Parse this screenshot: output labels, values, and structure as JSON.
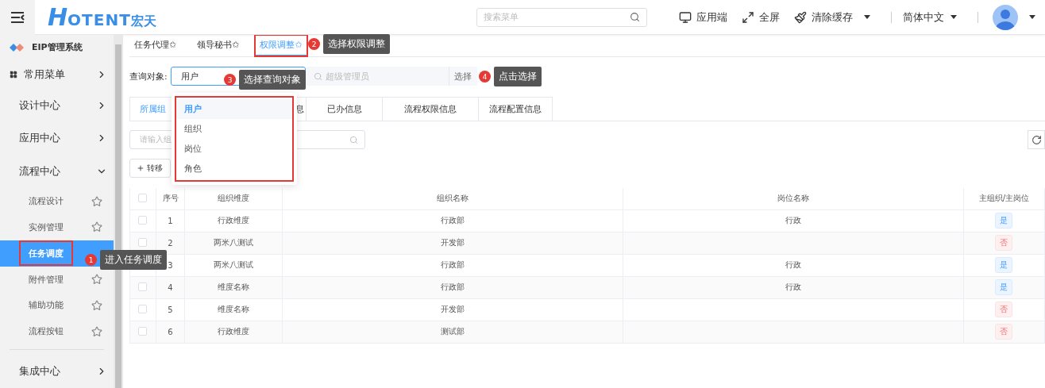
{
  "header": {
    "logo": {
      "mark": "H",
      "text": "OTENT",
      "suffix": "宏天"
    },
    "search": {
      "placeholder": "搜索菜单"
    },
    "actions": [
      {
        "kind": "monitor",
        "label": "应用端",
        "dropdown": false
      },
      {
        "kind": "expand",
        "label": "全屏",
        "dropdown": false
      },
      {
        "kind": "broom",
        "label": "清除缓存",
        "dropdown": true
      }
    ],
    "language": "简体中文"
  },
  "sidebar": {
    "title": "EIP管理系统",
    "items": [
      {
        "label": "常用菜单",
        "kind": "grid",
        "expanded": false
      },
      {
        "label": "设计中心",
        "expanded": false
      },
      {
        "label": "应用中心",
        "expanded": false
      },
      {
        "label": "流程中心",
        "expanded": true,
        "children": [
          {
            "label": "流程设计",
            "selected": false,
            "highlighted": false
          },
          {
            "label": "实例管理",
            "selected": false,
            "highlighted": false
          },
          {
            "label": "任务调度",
            "selected": true,
            "highlighted": true
          },
          {
            "label": "附件管理",
            "selected": false,
            "highlighted": false
          },
          {
            "label": "辅助功能",
            "selected": false,
            "highlighted": false
          },
          {
            "label": "流程按钮",
            "selected": false,
            "highlighted": false
          }
        ]
      },
      {
        "label": "集成中心",
        "expanded": false
      }
    ]
  },
  "page_tabs": [
    {
      "label": "任务代理✩",
      "selected": false,
      "highlighted": false
    },
    {
      "label": "领导秘书✩",
      "selected": false,
      "highlighted": false
    },
    {
      "label": "权限调整✩",
      "selected": true,
      "highlighted": true
    }
  ],
  "query": {
    "label": "查询对象:",
    "select": {
      "value": "用户"
    },
    "search": {
      "placeholder": "超级管理员"
    },
    "button": "选择"
  },
  "dropdown": {
    "highlighted": true,
    "options": [
      {
        "label": "用户",
        "selected": true
      },
      {
        "label": "组织",
        "selected": false
      },
      {
        "label": "岗位",
        "selected": false
      },
      {
        "label": "角色",
        "selected": false
      }
    ]
  },
  "sub_tabs": [
    {
      "label": "所属组",
      "selected": true
    },
    {
      "label": "息",
      "selected": false
    },
    {
      "label": "已办信息",
      "selected": false
    },
    {
      "label": "流程权限信息",
      "selected": false
    },
    {
      "label": "流程配置信息",
      "selected": false
    }
  ],
  "search": {
    "placeholder": "请输入组"
  },
  "toolbar": {
    "button": "转移"
  },
  "table": {
    "select_all": {
      "checked": false
    },
    "columns": [
      "序号",
      "组织维度",
      "组织名称",
      "岗位名称",
      "主组织/主岗位"
    ],
    "rows": [
      {
        "checked": false,
        "cells": [
          "1",
          "行政维度",
          "行政部",
          "行政"
        ],
        "primary": {
          "label": "是",
          "positive": true
        }
      },
      {
        "checked": false,
        "cells": [
          "2",
          "两米八测试",
          "开发部",
          ""
        ],
        "primary": {
          "label": "否",
          "positive": false
        }
      },
      {
        "cells": [
          "3",
          "两米八测试",
          "行政部",
          "行政"
        ],
        "primary": {
          "label": "是",
          "positive": true
        }
      },
      {
        "checked": false,
        "cells": [
          "4",
          "维度名称",
          "行政部",
          "行政"
        ],
        "primary": {
          "label": "是",
          "positive": true
        }
      },
      {
        "checked": false,
        "cells": [
          "5",
          "维度名称",
          "开发部",
          ""
        ],
        "primary": {
          "label": "否",
          "positive": false
        }
      },
      {
        "checked": false,
        "cells": [
          "6",
          "行政维度",
          "测试部",
          ""
        ],
        "primary": {
          "label": "否",
          "positive": false
        }
      }
    ]
  },
  "callouts": [
    {
      "number": "1",
      "text": "进入任务调度"
    },
    {
      "number": "2",
      "text": "选择权限调整"
    },
    {
      "number": "3",
      "text": "选择查询对象"
    },
    {
      "number": "4",
      "text": "点击选择"
    }
  ]
}
